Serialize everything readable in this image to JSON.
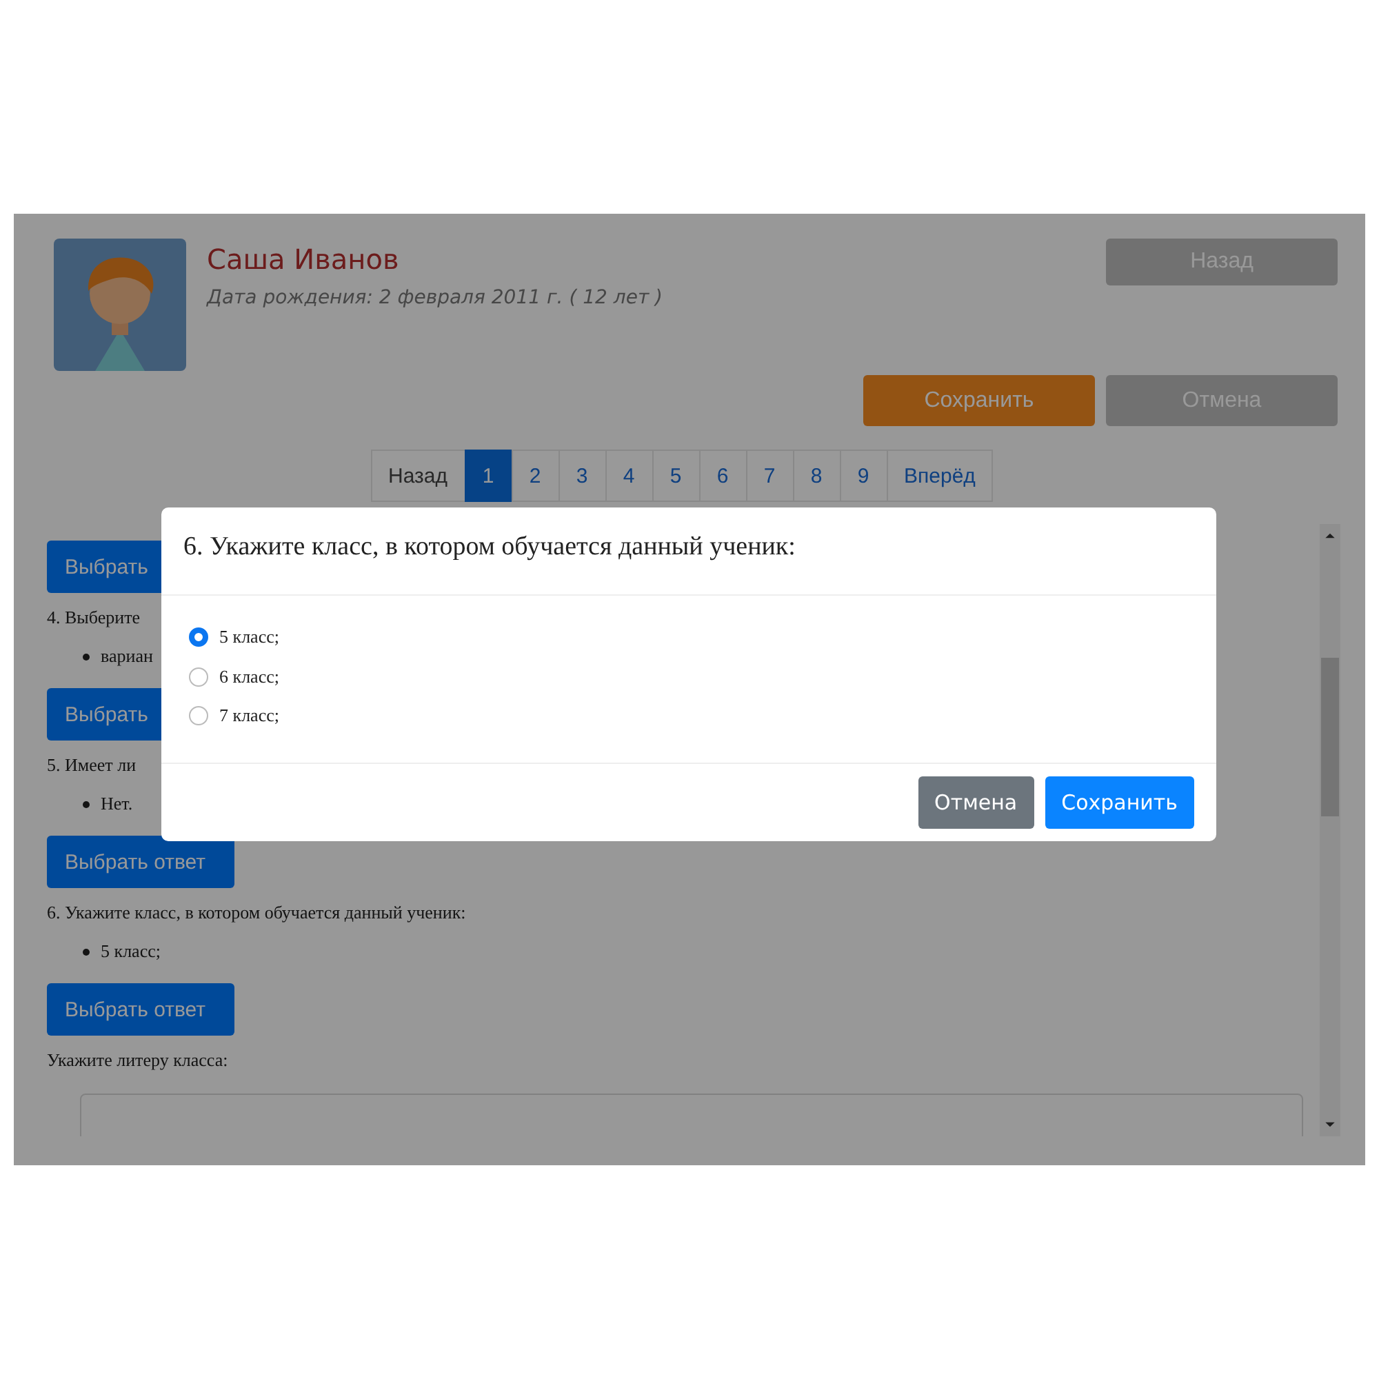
{
  "student": {
    "name": "Саша Иванов",
    "birth_info": "Дата рождения: 2 февраля 2011 г. ( 12 лет )"
  },
  "header_buttons": [
    {
      "label": "Назад",
      "kind": "secondary"
    }
  ],
  "action_buttons": [
    {
      "label": "Сохранить",
      "kind": "primary"
    },
    {
      "label": "Отмена",
      "kind": "secondary"
    }
  ],
  "pagination": {
    "prev": "Назад",
    "next": "Вперёд",
    "pages": [
      {
        "label": "1",
        "selected": true
      },
      {
        "label": "2",
        "selected": false
      },
      {
        "label": "3",
        "selected": false
      },
      {
        "label": "4",
        "selected": false
      },
      {
        "label": "5",
        "selected": false
      },
      {
        "label": "6",
        "selected": false
      },
      {
        "label": "7",
        "selected": false
      },
      {
        "label": "8",
        "selected": false
      },
      {
        "label": "9",
        "selected": false
      }
    ]
  },
  "questions": [
    {
      "kind": "button",
      "label": "Выбрать"
    },
    {
      "kind": "question",
      "text": "4. Выберите"
    },
    {
      "kind": "answer",
      "text": "вариан"
    },
    {
      "kind": "button",
      "label": "Выбрать"
    },
    {
      "kind": "question",
      "text": "5. Имеет ли"
    },
    {
      "kind": "answer",
      "text": "Нет."
    },
    {
      "kind": "button",
      "label": "Выбрать ответ"
    },
    {
      "kind": "question",
      "text": "6. Укажите класс, в котором обучается данный ученик:"
    },
    {
      "kind": "answer",
      "text": "5 класс;"
    },
    {
      "kind": "button",
      "label": "Выбрать ответ"
    },
    {
      "kind": "question",
      "text": "Укажите литеру класса:"
    },
    {
      "kind": "field"
    }
  ],
  "dialog": {
    "title": "6. Укажите класс, в котором обучается данный ученик:",
    "options": [
      {
        "label": "5 класс;",
        "selected": true
      },
      {
        "label": "6 класс;",
        "selected": false
      },
      {
        "label": "7 класс;",
        "selected": false
      }
    ],
    "buttons": [
      {
        "label": "Отмена",
        "kind": "secondary"
      },
      {
        "label": "Сохранить",
        "kind": "primary"
      }
    ]
  }
}
